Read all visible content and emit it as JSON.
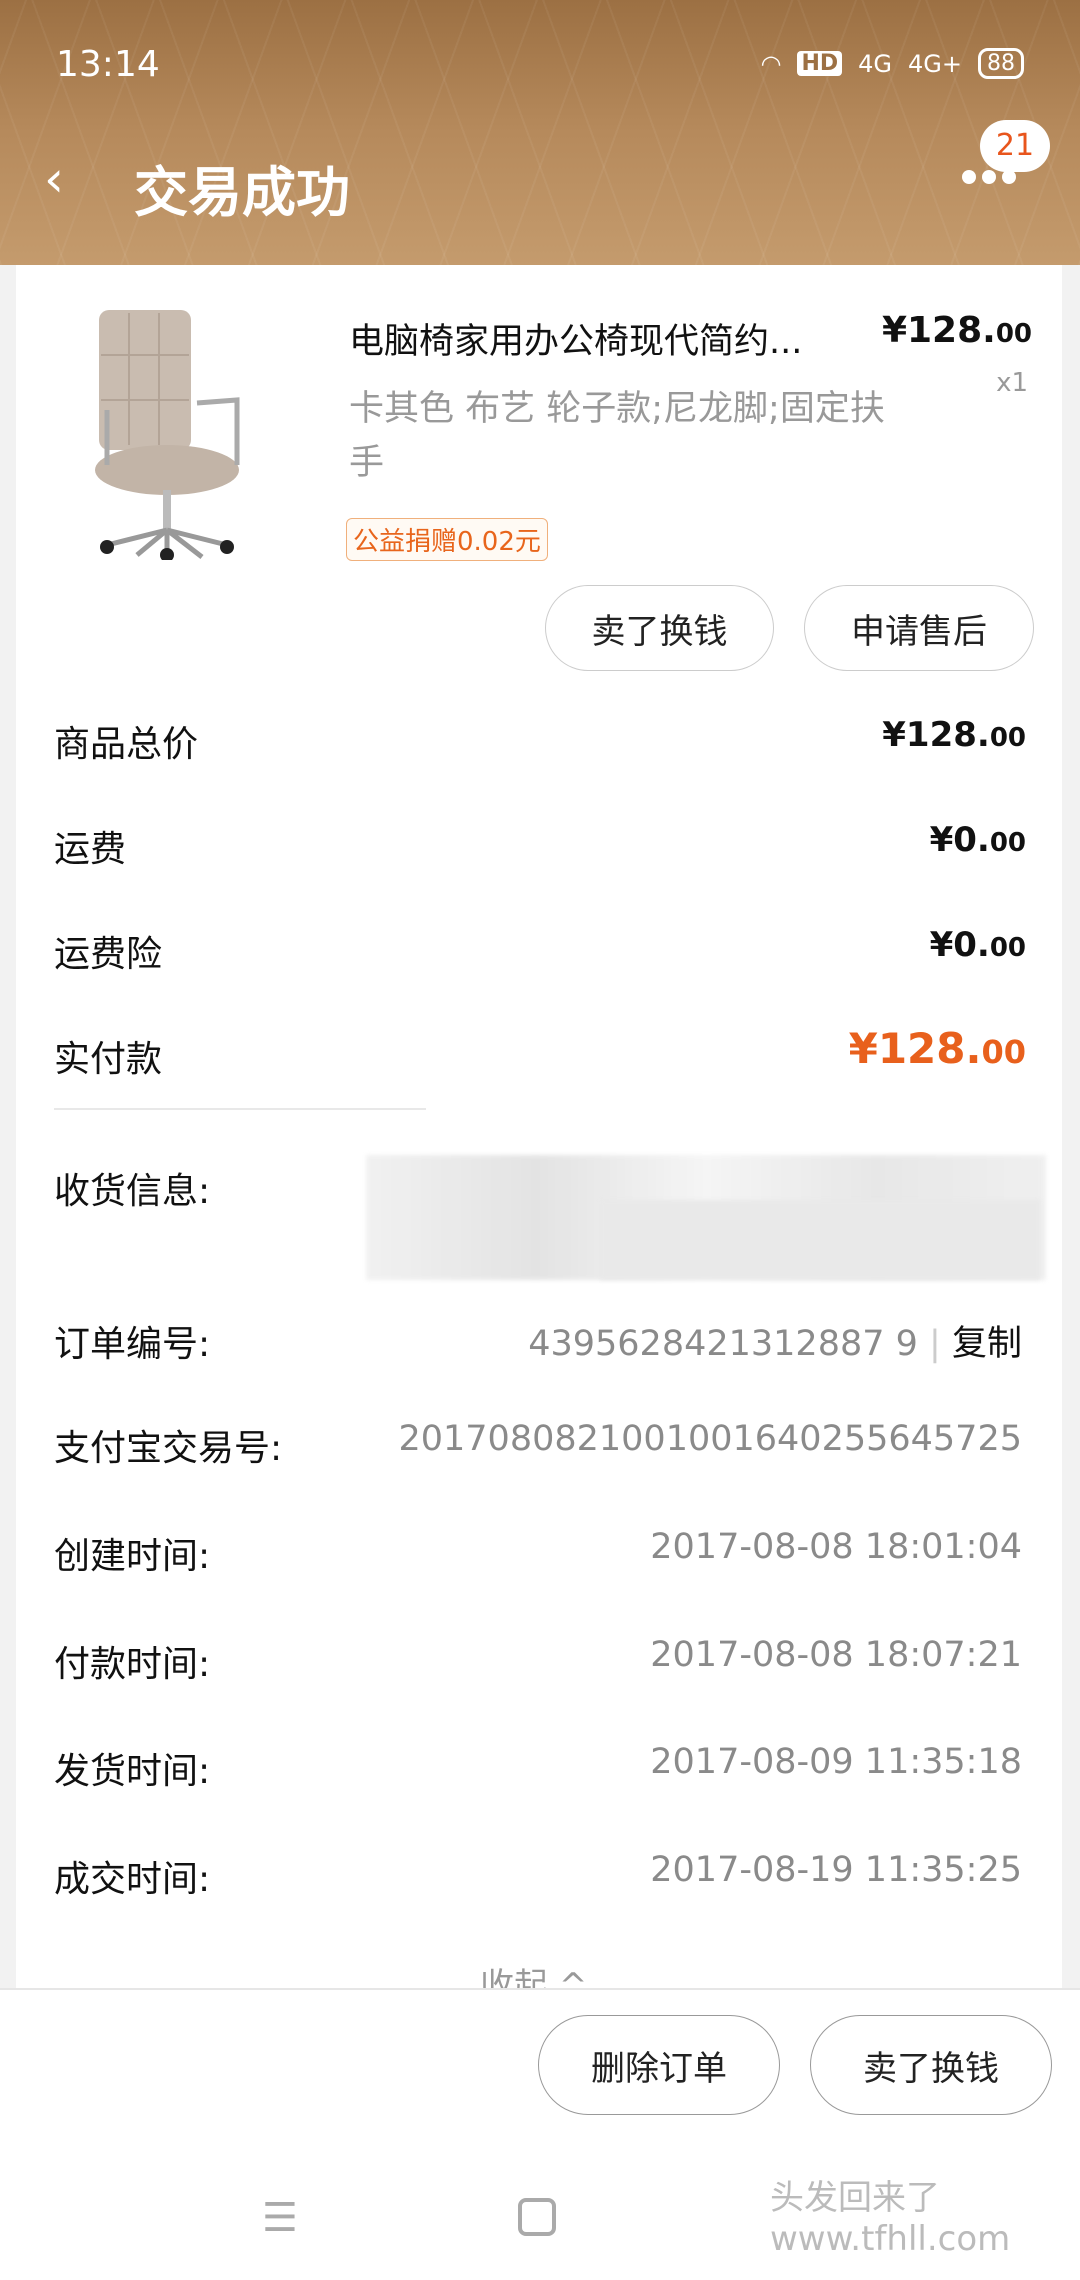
{
  "status_bar": {
    "time": "13:14",
    "network_1": "4G",
    "network_2": "4G+",
    "hd": "HD",
    "battery": "88"
  },
  "header": {
    "title": "交易成功",
    "back_icon": "chevron-left-icon",
    "more_icon": "more-dots-icon",
    "message_badge": "21"
  },
  "product": {
    "title": "电脑椅家用办公椅现代简约...",
    "price_int": "¥128.",
    "price_dec": "00",
    "quantity": "x1",
    "spec": "卡其色 布艺 轮子款;尼龙脚;固定扶手",
    "charity": "公益捐赠0.02元",
    "actions": [
      "卖了换钱",
      "申请售后"
    ]
  },
  "summary": [
    {
      "label": "商品总价",
      "int": "¥128.",
      "dec": "00"
    },
    {
      "label": "运费",
      "int": "¥0.",
      "dec": "00"
    },
    {
      "label": "运费险",
      "int": "¥0.",
      "dec": "00"
    },
    {
      "label": "实付款",
      "int": "¥128.",
      "dec": "00"
    }
  ],
  "accent_color": "#e8601c",
  "info": {
    "shipping_label": "收货信息:",
    "rows": [
      {
        "label": "订单编号:",
        "value": "4395628421312887 9",
        "copy": "复制"
      },
      {
        "label": "支付宝交易号:",
        "value": "2017080821001001640255645725"
      },
      {
        "label": "创建时间:",
        "value": "2017-08-08 18:01:04"
      },
      {
        "label": "付款时间:",
        "value": "2017-08-08 18:07:21"
      },
      {
        "label": "发货时间:",
        "value": "2017-08-09 11:35:18"
      },
      {
        "label": "成交时间:",
        "value": "2017-08-19 11:35:25"
      }
    ],
    "collapse": "收起"
  },
  "bottom_actions": [
    "删除订单",
    "卖了换钱"
  ],
  "watermark": "头发回来了 www.tfhll.com"
}
